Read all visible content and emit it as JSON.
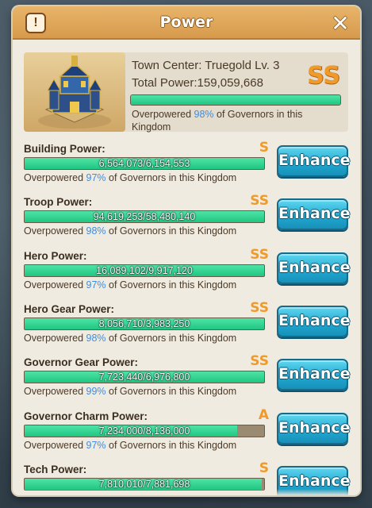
{
  "header": {
    "title": "Power",
    "info_label": "!",
    "close_label": "✕"
  },
  "summary": {
    "building_name": "Town Center: Truegold Lv. 3",
    "total_power": "Total Power:159,059,668",
    "grade": "SS",
    "progress": 1.0,
    "over_prefix": "Overpowered ",
    "over_percent": "98%",
    "over_suffix": " of Governors in this Kingdom"
  },
  "rows": [
    {
      "title": "Building Power:",
      "grade": "S",
      "value": "6,564,073/6,154,553",
      "progress": 1.0,
      "percent": "97%"
    },
    {
      "title": "Troop Power:",
      "grade": "SS",
      "value": "94,619,253/58,480,140",
      "progress": 1.0,
      "percent": "98%"
    },
    {
      "title": "Hero Power:",
      "grade": "SS",
      "value": "16,089,102/9,917,120",
      "progress": 1.0,
      "percent": "97%"
    },
    {
      "title": "Hero Gear Power:",
      "grade": "SS",
      "value": "8,056,710/3,983,250",
      "progress": 1.0,
      "percent": "98%"
    },
    {
      "title": "Governor Gear Power:",
      "grade": "SS",
      "value": "7,723,440/6,976,800",
      "progress": 1.0,
      "percent": "99%"
    },
    {
      "title": "Governor Charm Power:",
      "grade": "A",
      "value": "7,234,000/8,136,000",
      "progress": 0.889,
      "percent": "97%"
    },
    {
      "title": "Tech Power:",
      "grade": "S",
      "value": "7,810,010/7,881,698",
      "progress": 0.99,
      "percent": ""
    }
  ],
  "labels": {
    "enhance": "Enhance",
    "over_prefix": "Overpowered ",
    "over_suffix": " of Governors in this Kingdom"
  },
  "colors": {
    "accent_blue": "#3e8de0",
    "grade_orange": "#f09a2a",
    "bar_green": "#1fc682"
  },
  "icons": {
    "info": "info-icon",
    "close": "close-icon",
    "building": "town-center-icon"
  }
}
